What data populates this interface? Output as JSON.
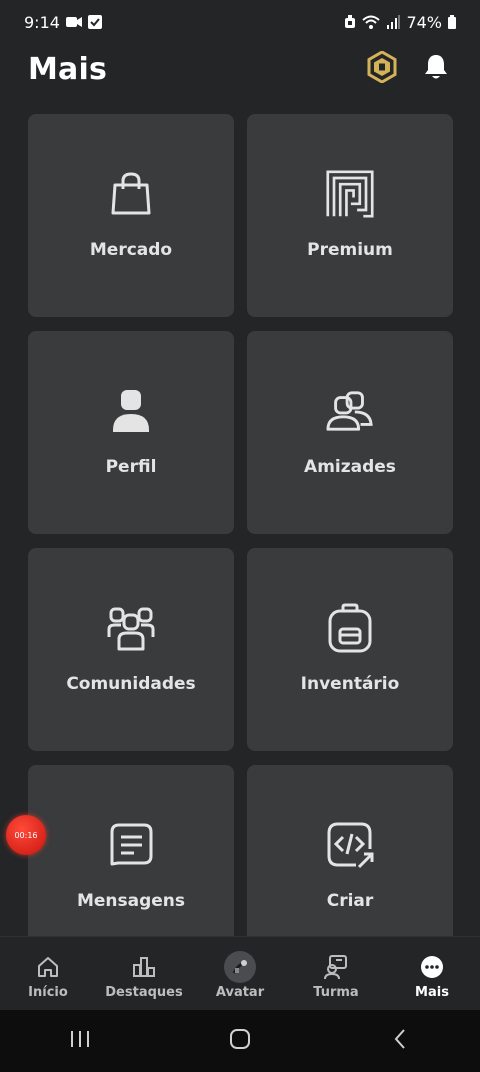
{
  "status_bar": {
    "time": "9:14",
    "battery": "74%"
  },
  "header": {
    "title": "Mais"
  },
  "tiles": [
    {
      "label": "Mercado",
      "icon": "shopping-bag-icon"
    },
    {
      "label": "Premium",
      "icon": "premium-icon"
    },
    {
      "label": "Perfil",
      "icon": "profile-icon"
    },
    {
      "label": "Amizades",
      "icon": "friends-icon"
    },
    {
      "label": "Comunidades",
      "icon": "communities-icon"
    },
    {
      "label": "Inventário",
      "icon": "backpack-icon"
    },
    {
      "label": "Mensagens",
      "icon": "message-icon"
    },
    {
      "label": "Criar",
      "icon": "code-icon"
    }
  ],
  "recording": {
    "time": "00:16"
  },
  "bottom_nav": [
    {
      "label": "Início",
      "icon": "home-icon",
      "active": false
    },
    {
      "label": "Destaques",
      "icon": "charts-icon",
      "active": false
    },
    {
      "label": "Avatar",
      "icon": "avatar-icon",
      "active": false
    },
    {
      "label": "Turma",
      "icon": "party-icon",
      "active": false
    },
    {
      "label": "Mais",
      "icon": "more-icon",
      "active": true
    }
  ],
  "colors": {
    "background": "#232527",
    "tile": "#393b3d",
    "accent_robux": "#d4b25a"
  }
}
